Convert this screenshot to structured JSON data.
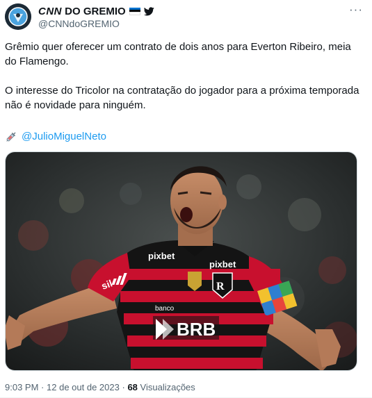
{
  "author": {
    "display_name_bold": "CNN",
    "display_name_rest": "DO GREMIO",
    "handle": "@CNNdoGREMIO",
    "badges": [
      "estonia-flag-icon",
      "bird-icon"
    ]
  },
  "tweet": {
    "paragraph_1": "Grêmio quer oferecer um contrato de dois anos para Everton Ribeiro, meia do Flamengo.",
    "paragraph_2": "O interesse do Tricolor na contratação do jogador para a próxima temporada não é novidade para ninguém.",
    "source_icon": "syringe-icon",
    "mention": "@JulioMiguelNeto"
  },
  "media": {
    "jersey_sponsor_1": "pixbet",
    "jersey_sponsor_2": "pixbet",
    "jersey_sponsor_3": "sil",
    "jersey_bank_small": "banco",
    "jersey_bank_big": "BRB"
  },
  "meta": {
    "time": "9:03 PM",
    "separator": "·",
    "date": "12 de out de 2023",
    "views_count": "68",
    "views_label": "Visualizações"
  },
  "colors": {
    "link": "#1d9bf0",
    "secondary_text": "#536471",
    "flamengo_red": "#c8102e",
    "flamengo_black": "#111111"
  }
}
